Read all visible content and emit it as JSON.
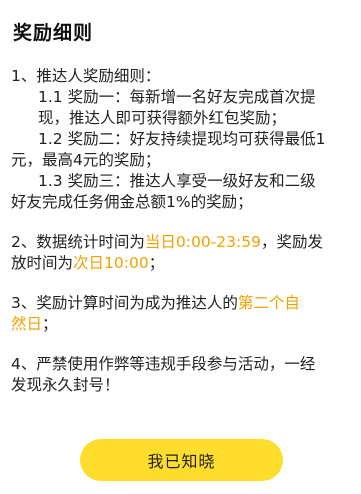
{
  "dialog": {
    "title": "奖励细则",
    "accent_color": "#f0a200",
    "button_color": "#ffdd2c",
    "rules": {
      "r1": {
        "heading": "1、推达人奖励细则：",
        "a": {
          "line1": "1.1 奖励一：每新增一名好友完成首次提",
          "line2": "现，推达人即可获得额外红包奖励；"
        },
        "b": {
          "line1": "1.2 奖励二：好友持续提现均可获得最低1",
          "line2": "元，最高4元的奖励；"
        },
        "c": {
          "line1": "1.3 奖励三：推达人享受一级好友和二级",
          "line2": "好友完成任务佣金总额1%的奖励；"
        }
      },
      "r2": {
        "part1": "2、数据统计时间为",
        "hl1": "当日0:00-23:59",
        "part2": "，奖励发",
        "part3": "放时间为",
        "hl2": "次日10:00",
        "part4": "；"
      },
      "r3": {
        "part1": "3、奖励计算时间为成为推达人的",
        "hl1": "第二个自",
        "hl2": "然日",
        "part2": "；"
      },
      "r4": {
        "line1": "4、严禁使用作弊等违规手段参与活动，一经",
        "line2": "发现永久封号！"
      }
    },
    "confirm_label": "我已知晓"
  }
}
